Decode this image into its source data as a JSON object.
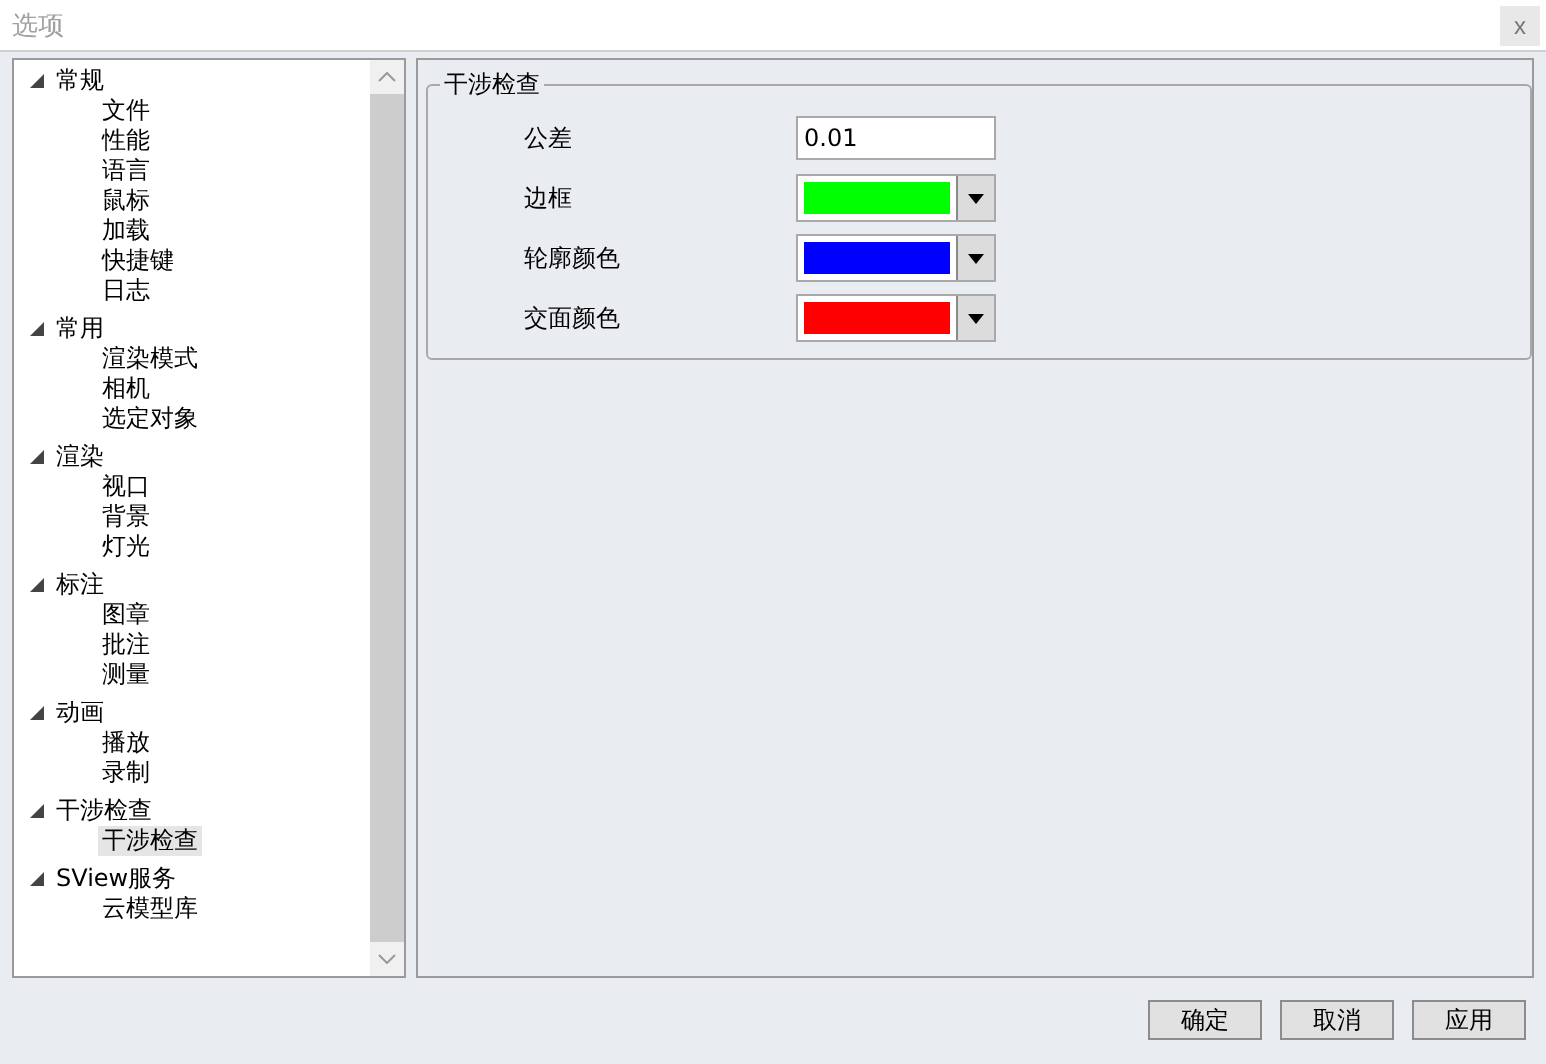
{
  "window": {
    "title": "选项",
    "close": "x"
  },
  "tree": [
    {
      "label": "常规",
      "expanded": true,
      "children": [
        {
          "label": "文件",
          "selected": false
        },
        {
          "label": "性能",
          "selected": false
        },
        {
          "label": "语言",
          "selected": false
        },
        {
          "label": "鼠标",
          "selected": false
        },
        {
          "label": "加载",
          "selected": false
        },
        {
          "label": "快捷键",
          "selected": false
        },
        {
          "label": "日志",
          "selected": false
        }
      ]
    },
    {
      "label": "常用",
      "expanded": true,
      "children": [
        {
          "label": "渲染模式",
          "selected": false
        },
        {
          "label": "相机",
          "selected": false
        },
        {
          "label": "选定对象",
          "selected": false
        }
      ]
    },
    {
      "label": "渲染",
      "expanded": true,
      "children": [
        {
          "label": "视口",
          "selected": false
        },
        {
          "label": "背景",
          "selected": false
        },
        {
          "label": "灯光",
          "selected": false
        }
      ]
    },
    {
      "label": "标注",
      "expanded": true,
      "children": [
        {
          "label": "图章",
          "selected": false
        },
        {
          "label": "批注",
          "selected": false
        },
        {
          "label": "测量",
          "selected": false
        }
      ]
    },
    {
      "label": "动画",
      "expanded": true,
      "children": [
        {
          "label": "播放",
          "selected": false
        },
        {
          "label": "录制",
          "selected": false
        }
      ]
    },
    {
      "label": "干涉检查",
      "expanded": true,
      "children": [
        {
          "label": "干涉检查",
          "selected": true
        }
      ]
    },
    {
      "label": "SView服务",
      "expanded": true,
      "children": [
        {
          "label": "云模型库",
          "selected": false
        }
      ]
    }
  ],
  "group": {
    "title": "干涉检查",
    "fields": [
      {
        "kind": "text",
        "label": "公差",
        "value": "0.01"
      },
      {
        "kind": "color",
        "label": "边框",
        "color": "#00ff00"
      },
      {
        "kind": "color",
        "label": "轮廓颜色",
        "color": "#0000ff"
      },
      {
        "kind": "color",
        "label": "交面颜色",
        "color": "#ff0000"
      }
    ]
  },
  "buttons": [
    "确定",
    "取消",
    "应用"
  ]
}
